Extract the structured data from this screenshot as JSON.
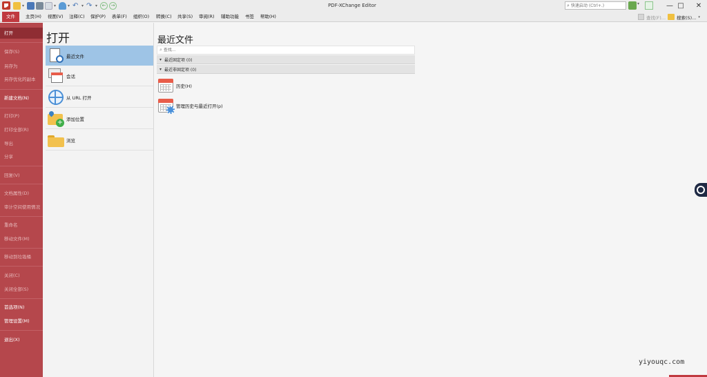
{
  "window": {
    "title": "PDF-XChange Editor"
  },
  "quick_search": {
    "placeholder": "快速启动 (Ctrl+.)"
  },
  "menu": {
    "items": [
      "文件",
      "主页(H)",
      "视图(V)",
      "注释(C)",
      "保护(P)",
      "表单(F)",
      "组织(O)",
      "转换(C)",
      "共享(S)",
      "审阅(R)",
      "辅助功能",
      "书签",
      "帮助(H)"
    ],
    "find_label": "查找(F)...",
    "search_label": "搜索(S)..."
  },
  "sidebar": {
    "items": [
      {
        "label": "打开"
      },
      {
        "label": "保存(S)"
      },
      {
        "label": "另存为"
      },
      {
        "label": "另存优化的副本"
      },
      {
        "label": "新建文档(N)"
      },
      {
        "label": "打印(P)"
      },
      {
        "label": "打印全部(R)"
      },
      {
        "label": "导出"
      },
      {
        "label": "分享"
      },
      {
        "label": "回复(V)"
      },
      {
        "label": "文档属性(D)"
      },
      {
        "label": "审计空间使用情况"
      },
      {
        "label": "重命名"
      },
      {
        "label": "移动文件(M)"
      },
      {
        "label": "移动到垃圾桶"
      },
      {
        "label": "关闭(C)"
      },
      {
        "label": "关闭全部(S)"
      },
      {
        "label": "首选项(N)"
      },
      {
        "label": "管理设置(M)"
      },
      {
        "label": "退出(X)"
      }
    ]
  },
  "open_panel": {
    "title": "打开",
    "items": [
      {
        "label": "最近文件"
      },
      {
        "label": "会话"
      },
      {
        "label": "从 URL 打开"
      },
      {
        "label": "添加位置"
      },
      {
        "label": "浏览"
      }
    ]
  },
  "recent": {
    "title": "最近文件",
    "search_placeholder": "查找...",
    "groups": [
      {
        "label": "最近固定项 (0)"
      },
      {
        "label": "最近非固定项 (0)"
      }
    ],
    "items": [
      {
        "label": "历史(H)"
      },
      {
        "label": "管理历史与最近打开(p)"
      }
    ]
  },
  "watermark": "yiyouqc.com",
  "colors": {
    "sidebar": "#b5474c",
    "accent": "#c0393f",
    "selection": "#9ec4e6"
  }
}
